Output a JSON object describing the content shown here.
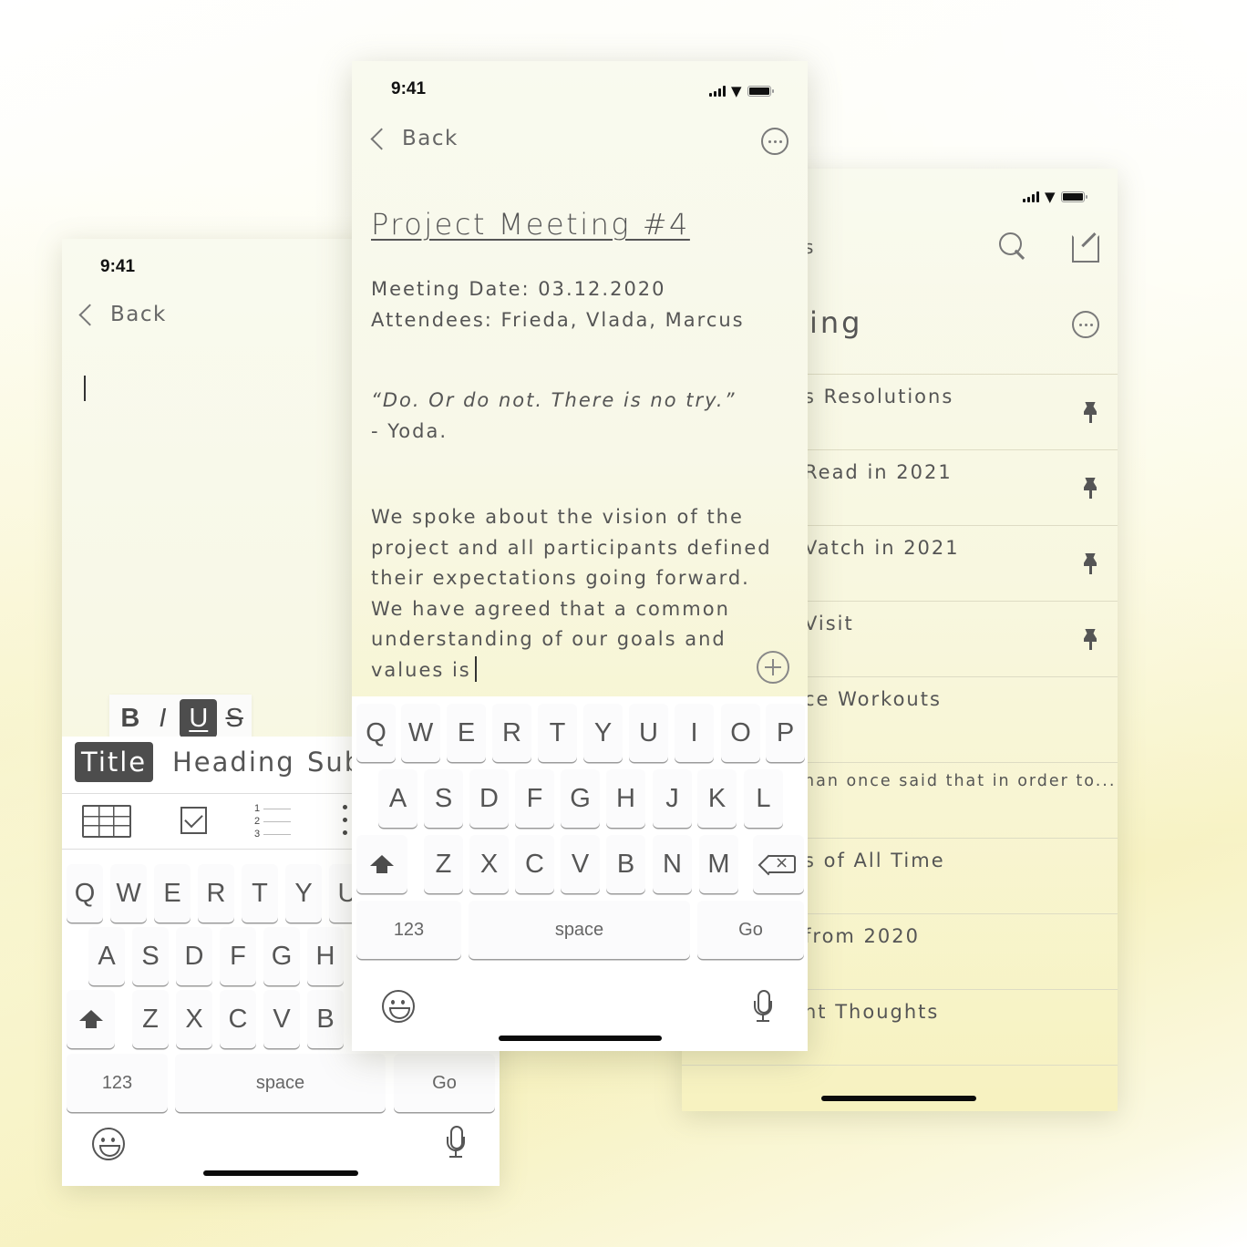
{
  "status": {
    "time": "9:41"
  },
  "left_screen": {
    "back_label": "Back",
    "format_buttons": [
      "B",
      "I",
      "U",
      "S"
    ],
    "active_format": "U",
    "text_styles": [
      "Title",
      "Heading",
      "Sub"
    ],
    "active_style": "Title",
    "insert_tools": [
      "table-icon",
      "checklist-icon",
      "numbered-list-icon",
      "bulleted-list-icon"
    ],
    "numbered_list_glyph": [
      "1",
      "2",
      "3"
    ],
    "keyboard": {
      "row1": [
        "Q",
        "W",
        "E",
        "R",
        "T",
        "Y",
        "U"
      ],
      "row2": [
        "A",
        "S",
        "D",
        "F",
        "G",
        "H"
      ],
      "row3": [
        "Z",
        "X",
        "C",
        "V",
        "B"
      ],
      "numbers_label": "123",
      "space_label": "space",
      "go_label": "Go"
    }
  },
  "middle_screen": {
    "back_label": "Back",
    "note_title": "Project Meeting #4",
    "meeting_date": "Meeting Date: 03.12.2020",
    "attendees": "Attendees: Frieda, Vlada, Marcus",
    "quote": "“Do. Or do not. There is no try.”",
    "quote_author": "- Yoda.",
    "body_lines": [
      "We spoke about the vision of the",
      "project and all participants defined",
      "their expectations going forward.",
      "We have agreed that a common",
      "understanding of our goals and",
      "values is"
    ],
    "keyboard": {
      "row1": [
        "Q",
        "W",
        "E",
        "R",
        "T",
        "Y",
        "U",
        "I",
        "O",
        "P"
      ],
      "row2": [
        "A",
        "S",
        "D",
        "F",
        "G",
        "H",
        "J",
        "K",
        "L"
      ],
      "row3": [
        "Z",
        "X",
        "C",
        "V",
        "B",
        "N",
        "M"
      ],
      "numbers_label": "123",
      "space_label": "space",
      "go_label": "Go"
    }
  },
  "right_screen": {
    "nav_title_partial": "s",
    "heading_partial": "ing",
    "notes": [
      {
        "title": "s Resolutions",
        "pinned": true
      },
      {
        "title": "Read in 2021",
        "pinned": true
      },
      {
        "title": "Vatch in 2021",
        "pinned": true
      },
      {
        "title": "Visit",
        "pinned": true
      },
      {
        "title": "ce Workouts",
        "pinned": false
      },
      {
        "title": "nan once said that in order to...",
        "pinned": false
      },
      {
        "title": "s of All Time",
        "pinned": false
      },
      {
        "title": "from 2020",
        "pinned": false
      },
      {
        "title": "ht Thoughts",
        "pinned": false
      }
    ]
  },
  "colors": {
    "accent_dark": "#4d4d4d",
    "note_bg_top": "#f9faef",
    "note_bg_bottom": "#f7f2c0",
    "text": "#555555"
  }
}
